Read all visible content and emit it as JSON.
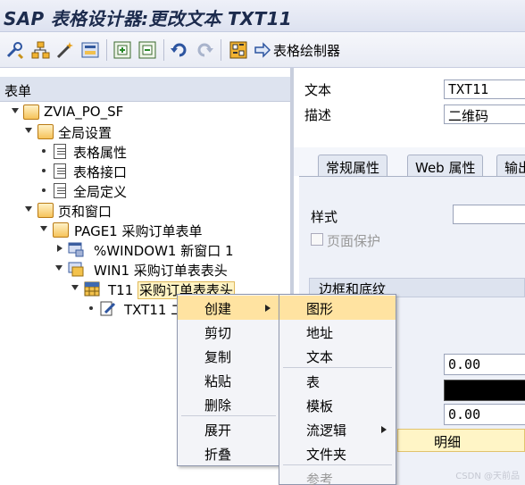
{
  "title": "SAP 表格设计器:更改文本 TXT11",
  "toolbar": {
    "icons": [
      "tools-icon",
      "hierarchy-icon",
      "magic-wand-icon",
      "layout-icon",
      "insert-window-icon",
      "delete-window-icon",
      "undo-icon",
      "redo-icon",
      "form-check-icon",
      "arrow-right-icon"
    ],
    "painter_label": "表格绘制器"
  },
  "left": {
    "header": "表单",
    "tree": [
      {
        "label": "ZVIA_PO_SF",
        "icon": "folder-open-icon",
        "toggle": "down"
      },
      {
        "label": "全局设置",
        "icon": "folder-open-icon",
        "toggle": "down"
      },
      {
        "label": "表格属性",
        "icon": "document-icon",
        "toggle": "dot"
      },
      {
        "label": "表格接口",
        "icon": "document-icon",
        "toggle": "dot"
      },
      {
        "label": "全局定义",
        "icon": "document-icon",
        "toggle": "dot"
      },
      {
        "label": "页和窗口",
        "icon": "folder-open-icon",
        "toggle": "down"
      },
      {
        "label": "PAGE1 采购订单表单",
        "icon": "folder-open-icon",
        "toggle": "down"
      },
      {
        "label": "%WINDOW1 新窗口 1",
        "icon": "window-icon",
        "toggle": "right"
      },
      {
        "label": "WIN1 采购订单表表头",
        "icon": "window-icon",
        "toggle": "down"
      },
      {
        "label_prefix": "T11",
        "label_hl": "采购订单表表头",
        "icon": "table-icon",
        "toggle": "down"
      },
      {
        "label": "TXT11 二",
        "icon": "text-edit-icon",
        "toggle": "dot"
      }
    ]
  },
  "right": {
    "text_label": "文本",
    "text_value": "TXT11",
    "desc_label": "描述",
    "desc_value": "二维码",
    "tabs": [
      "常规属性",
      "Web 属性",
      "输出"
    ],
    "style_label": "样式",
    "protect_label": "页面保护",
    "section_label": "边框和底纹",
    "value1": "0.00",
    "value2": "0.00",
    "detail_label": "明细"
  },
  "context_menu": {
    "items": [
      "创建",
      "剪切",
      "复制",
      "粘贴",
      "删除",
      "展开",
      "折叠"
    ],
    "selected": "创建"
  },
  "submenu": {
    "items": [
      "图形",
      "地址",
      "文本",
      "表",
      "模板",
      "流逻辑",
      "文件夹",
      "参考"
    ],
    "selected": "图形",
    "disabled": [
      "参考"
    ]
  },
  "watermark": "CSDN @天前品",
  "colors": {
    "menu_highlight": "#ffe3a1",
    "tree_highlight": "#fff3c4",
    "folder": "#f0a830"
  }
}
